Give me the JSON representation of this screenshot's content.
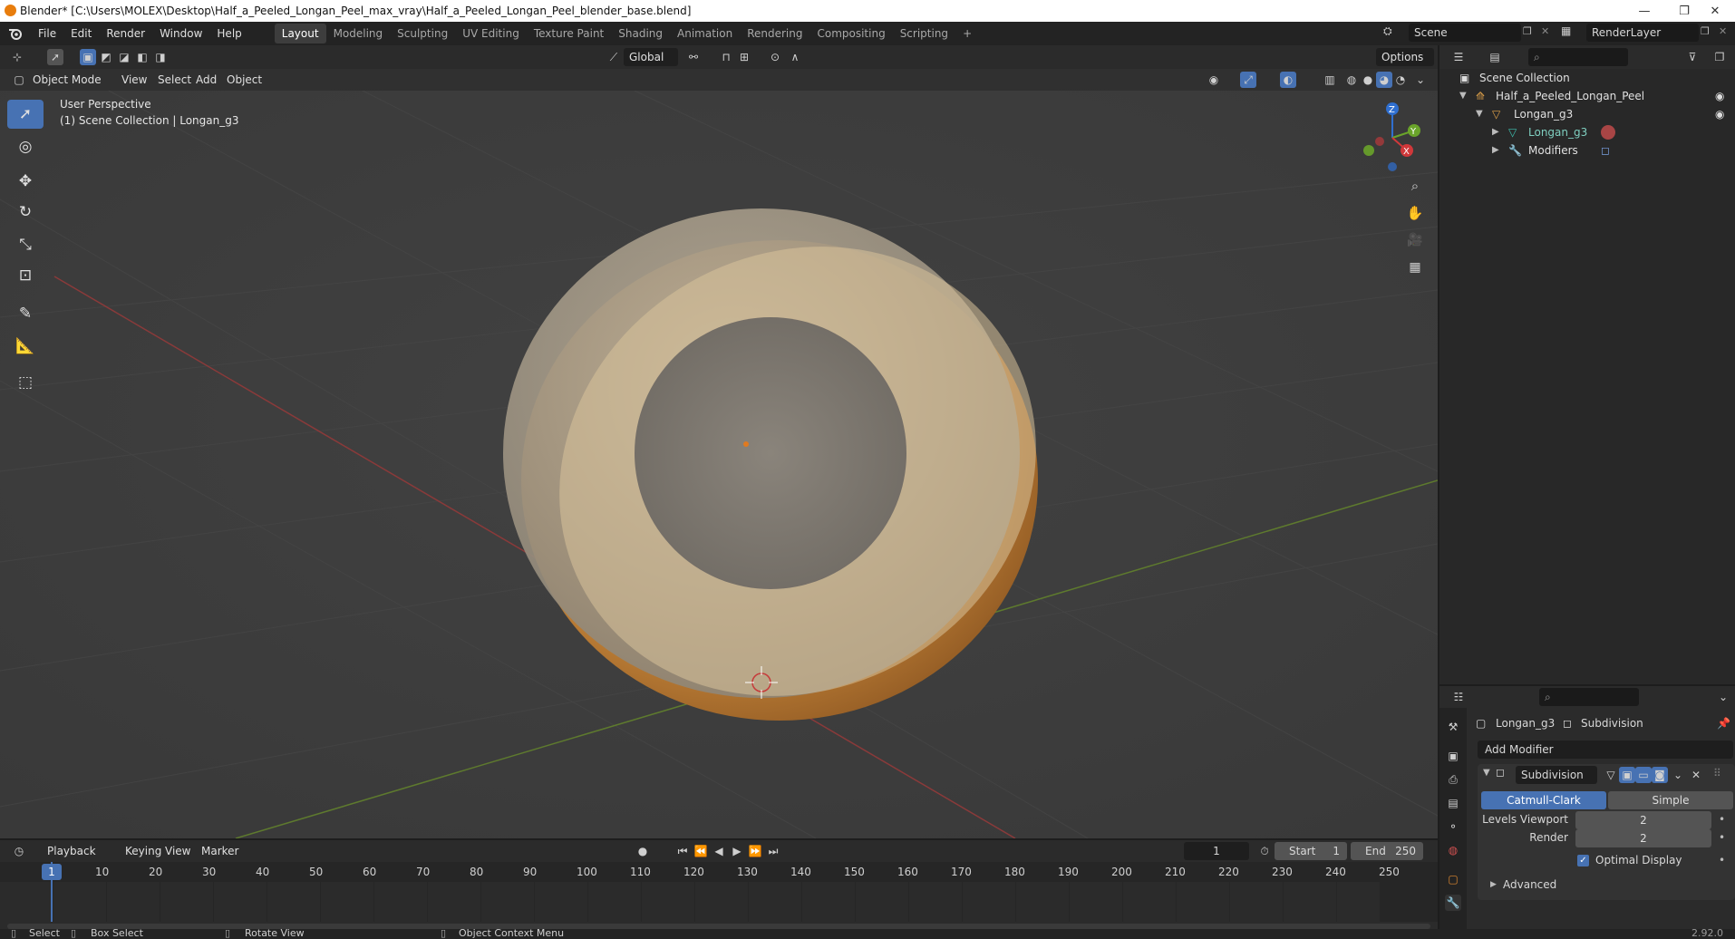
{
  "window": {
    "title": "Blender* [C:\\Users\\MOLEX\\Desktop\\Half_a_Peeled_Longan_Peel_max_vray\\Half_a_Peeled_Longan_Peel_blender_base.blend]",
    "minimize": "—",
    "restore": "❐",
    "close": "✕"
  },
  "menu": {
    "items": [
      "File",
      "Edit",
      "Render",
      "Window",
      "Help"
    ]
  },
  "workspaces": [
    "Layout",
    "Modeling",
    "Sculpting",
    "UV Editing",
    "Texture Paint",
    "Shading",
    "Animation",
    "Rendering",
    "Compositing",
    "Scripting"
  ],
  "workspace_add": "+",
  "scene": {
    "label": "Scene",
    "render_layer": "RenderLayer"
  },
  "header": {
    "transform_orientation": "Global",
    "options_label": "Options"
  },
  "viewport_header": {
    "mode": "Object Mode",
    "menus": [
      "View",
      "Select",
      "Add",
      "Object"
    ]
  },
  "viewport": {
    "perspective_label": "User Perspective",
    "collection_label": "(1) Scene Collection | Longan_g3",
    "gizmo": {
      "z": "Z",
      "y": "Y",
      "x": "X"
    }
  },
  "outliner": {
    "rows": [
      {
        "label": "Scene Collection"
      },
      {
        "label": "Half_a_Peeled_Longan_Peel"
      },
      {
        "label": "Longan_g3"
      },
      {
        "label": "Longan_g3"
      },
      {
        "label": "Modifiers"
      }
    ]
  },
  "properties": {
    "object_name": "Longan_g3",
    "modifier_crumb": "Subdivision",
    "add_modifier": "Add Modifier",
    "modifier_name": "Subdivision",
    "catmull_clark": "Catmull-Clark",
    "simple": "Simple",
    "levels_viewport_label": "Levels Viewport",
    "levels_viewport_value": "2",
    "render_label": "Render",
    "render_value": "2",
    "optimal_display": "Optimal Display",
    "advanced": "Advanced"
  },
  "timeline": {
    "menus": [
      "Playback",
      "Keying",
      "View",
      "Marker"
    ],
    "current_frame": "1",
    "start_label": "Start",
    "start_value": "1",
    "end_label": "End",
    "end_value": "250",
    "playhead": "1",
    "ticks": [
      "10",
      "20",
      "30",
      "40",
      "50",
      "60",
      "70",
      "80",
      "90",
      "100",
      "110",
      "120",
      "130",
      "140",
      "150",
      "160",
      "170",
      "180",
      "190",
      "200",
      "210",
      "220",
      "230",
      "240",
      "250"
    ]
  },
  "statusbar": {
    "select": "Select",
    "box_select": "Box Select",
    "rotate_view": "Rotate View",
    "context_menu": "Object Context Menu",
    "version": "2.92.0"
  }
}
